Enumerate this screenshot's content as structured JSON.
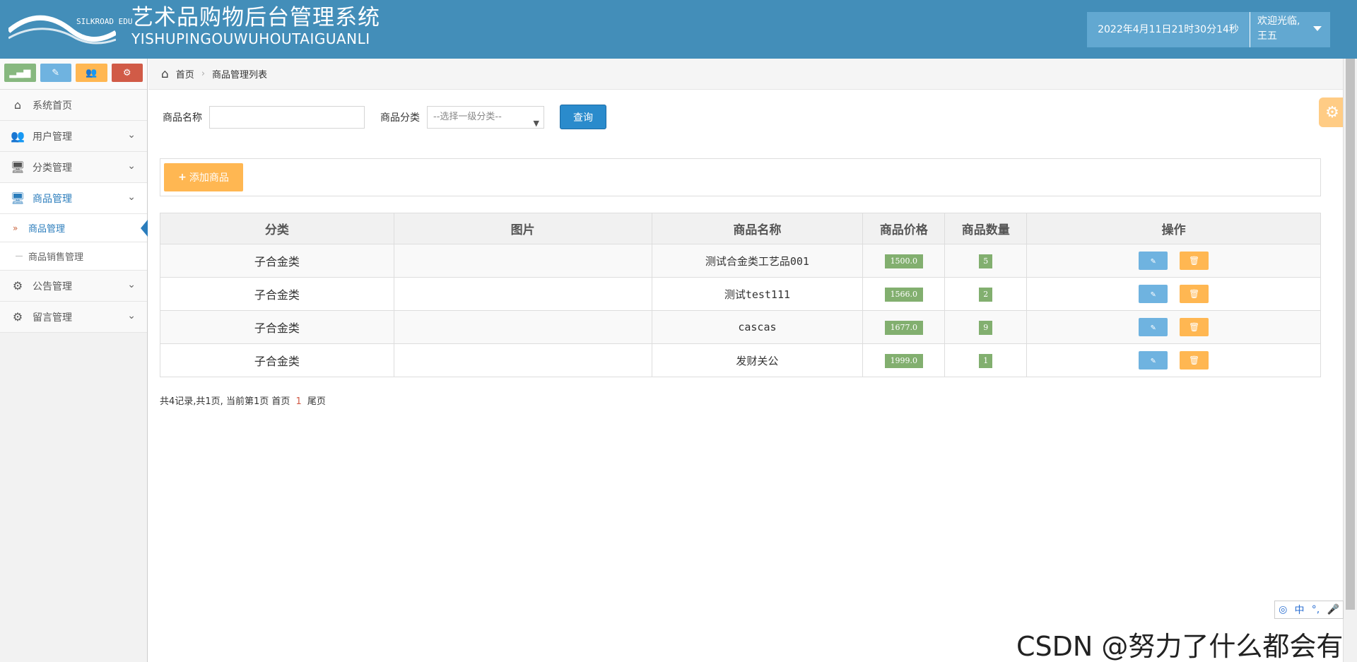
{
  "header": {
    "logo_text": "SILKROAD EDU",
    "title_cn": "艺术品购物后台管理系统",
    "title_en": "YISHUPINGOUWUHOUTAIGUANLI",
    "datetime": "2022年4月11日21时30分14秒",
    "welcome": "欢迎光临,",
    "username": "王五",
    "colors": {
      "header_bg": "#438eb9",
      "info_bg": "#62a8d1"
    }
  },
  "sidebar": {
    "shortcuts": [
      {
        "icon": "signal-icon",
        "color": "#87b87f"
      },
      {
        "icon": "pencil-icon",
        "color": "#6fb3e0"
      },
      {
        "icon": "users-icon",
        "color": "#ffb752"
      },
      {
        "icon": "cogs-icon",
        "color": "#d15b47"
      }
    ],
    "items": [
      {
        "label": "系统首页",
        "icon": "home-icon"
      },
      {
        "label": "用户管理",
        "icon": "users-icon"
      },
      {
        "label": "分类管理",
        "icon": "desktop-icon"
      },
      {
        "label": "商品管理",
        "icon": "desktop-icon"
      },
      {
        "label": "公告管理",
        "icon": "cogs-icon"
      },
      {
        "label": "留言管理",
        "icon": "cogs-icon"
      }
    ],
    "sub_items": [
      {
        "label": "商品管理"
      },
      {
        "label": "商品销售管理"
      }
    ]
  },
  "breadcrumbs": {
    "home": "首页",
    "current": "商品管理列表"
  },
  "search": {
    "name_label": "商品名称",
    "name_value": "",
    "category_label": "商品分类",
    "category_selected": "--选择一级分类--",
    "query_button": "查询"
  },
  "add_button": "添加商品",
  "table": {
    "headers": [
      "分类",
      "图片",
      "商品名称",
      "商品价格",
      "商品数量",
      "操作"
    ],
    "rows": [
      {
        "category": "子合金类",
        "image": "",
        "name": "测试合金类工艺品001",
        "price": "1500.0",
        "quantity": "5"
      },
      {
        "category": "子合金类",
        "image": "",
        "name": "测试test111",
        "price": "1566.0",
        "quantity": "2"
      },
      {
        "category": "子合金类",
        "image": "",
        "name": "cascas",
        "price": "1677.0",
        "quantity": "9"
      },
      {
        "category": "子合金类",
        "image": "",
        "name": "发财关公",
        "price": "1999.0",
        "quantity": "1"
      }
    ]
  },
  "pager": {
    "summary": "共4记录,共1页, 当前第1页 首页",
    "current_page": "1",
    "last": "尾页"
  },
  "ime": {
    "lang": "中",
    "punct": "°,"
  },
  "watermark": "CSDN @努力了什么都会有"
}
